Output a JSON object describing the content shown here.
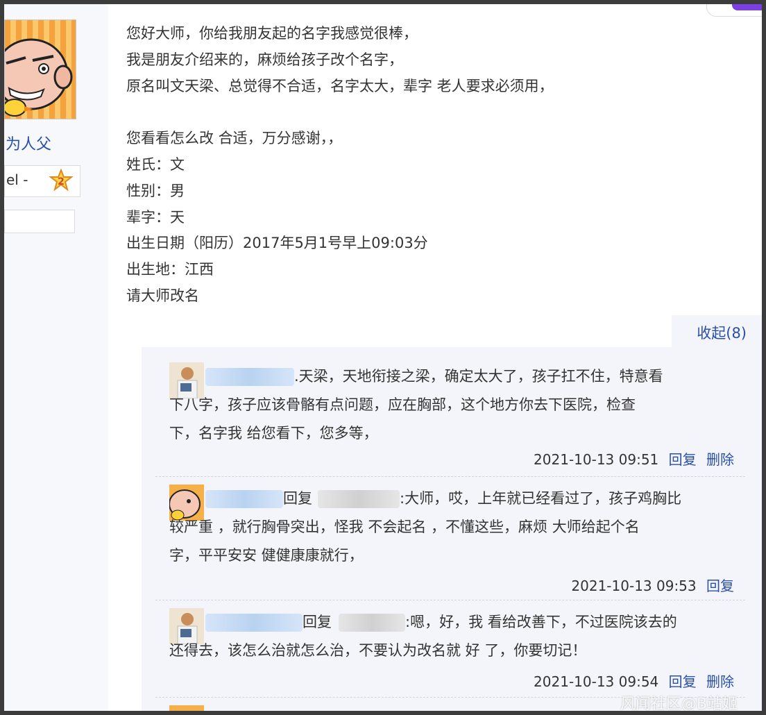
{
  "user_panel": {
    "username": "为人父",
    "level_label": "el -",
    "level_number": "2"
  },
  "post": {
    "lines": [
      "您好大师，你给我朋友起的名字我感觉很棒，",
      "我是朋友介绍来的，麻烦给孩子改个名字，",
      "原名叫文天梁、总觉得不合适，名字太大，辈字 老人要求必须用，",
      "",
      "您看看怎么改 合适，万分感谢，，",
      "姓氏：文",
      "性别：男",
      "辈字：天",
      "出生日期（阳历）2017年5月1号早上09:03分",
      "出生地：江西",
      "请大师改名"
    ]
  },
  "fold_label": "收起(8)",
  "comments": [
    {
      "line1_text": ".天梁，天地衔接之梁，确定太大了，孩子扛不住，特意看",
      "line2": "下八字，孩子应该骨骼有点问题，应在胸部，这个地方你去下医院，检查",
      "line3": "下，名字我 给您看下，您多等，",
      "time": "2021-10-13 09:51",
      "reply": "回复",
      "delete": "删除"
    },
    {
      "reply_word": "回复",
      "line1_text": ":大师，哎，上年就已经看过了，孩子鸡胸比",
      "line2": "较严重 ，就行胸骨突出，怪我 不会起名 ，不懂这些，麻烦 大师给起个名",
      "line3": "字，平平安安 健健康康就行，",
      "time": "2021-10-13 09:53",
      "reply": "回复"
    },
    {
      "reply_word": "回复",
      "line1_text": ":嗯，好，我 看给改善下，不过医院该去的",
      "line2": "还得去，该怎么治就怎么治，不要认为改名就 好 了，你要切记！",
      "time": "2021-10-13 09:54",
      "reply": "回复",
      "delete": "删除"
    }
  ],
  "watermark": "风闻社区@B站姬"
}
